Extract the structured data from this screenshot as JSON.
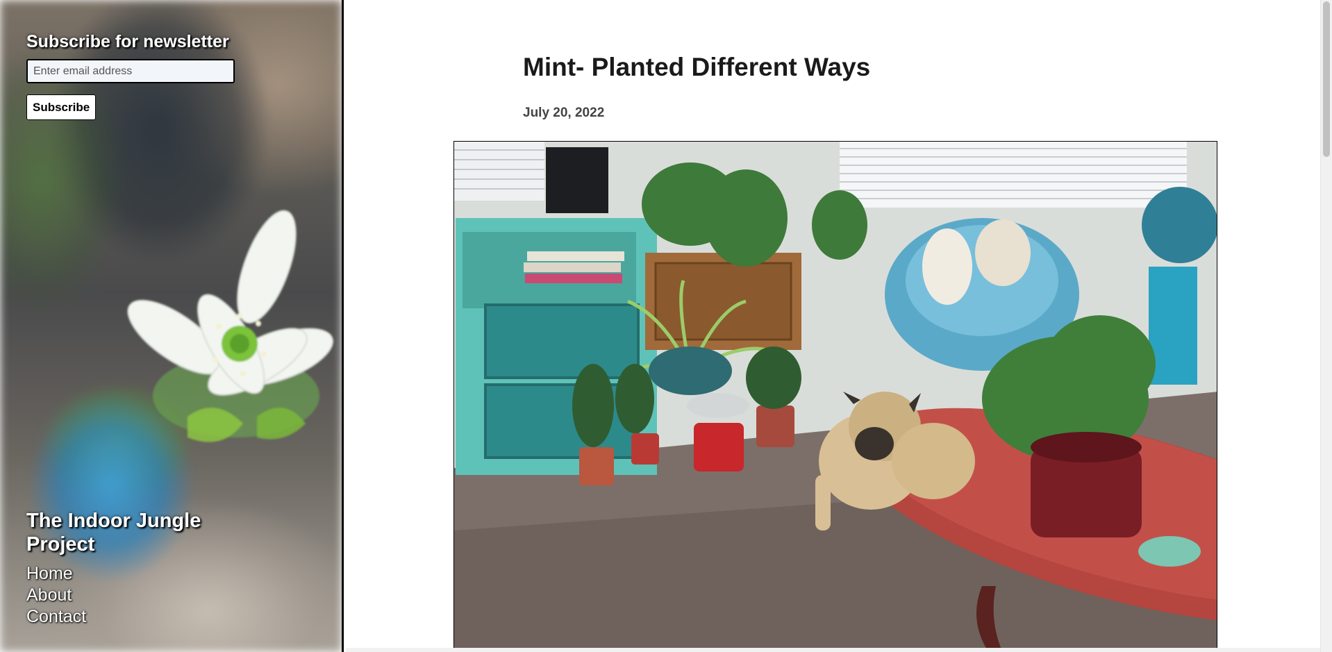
{
  "sidebar": {
    "newsletter": {
      "title": "Subscribe for newsletter",
      "email_placeholder": "Enter email address",
      "subscribe_label": "Subscribe"
    },
    "site_title": "The Indoor Jungle Project",
    "nav": [
      {
        "label": "Home"
      },
      {
        "label": "About"
      },
      {
        "label": "Contact"
      }
    ]
  },
  "post": {
    "title": "Mint- Planted Different Ways",
    "date": "July 20, 2022"
  },
  "colors": {
    "accent_teal": "#5fc2b8",
    "text_dark": "#1a1a1a"
  }
}
